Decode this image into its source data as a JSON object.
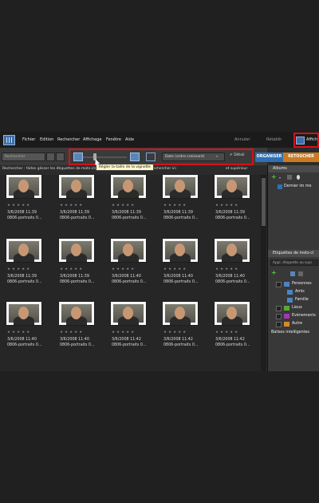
{
  "colors": {
    "accent_blue": "#2f6fb4",
    "accent_orange": "#c97a22",
    "highlight_red": "#d3121b"
  },
  "menu": {
    "items": [
      "Fichier",
      "Edition",
      "Rechercher",
      "Affichage",
      "Fenêtre",
      "Aide"
    ],
    "undo": "Annuler",
    "redo": "Rétablir",
    "afficher": "Affich"
  },
  "toolbar": {
    "search_label": "Rechercher",
    "sort_value": "Date (ordre croissant)",
    "detail_label": "✔ Détail",
    "slider_tooltip": "Régler la taille de la vignette"
  },
  "hint": {
    "text_left": "Rechercher : faites glisser les étiquettes de mots-clés",
    "text_mid": "rechercher ici",
    "text_right": "et supérieur"
  },
  "tabs": {
    "organize": "ORGANISER",
    "retouch": "RETOUCHER"
  },
  "photos": [
    {
      "date": "3/6/2008 11:39",
      "name": "0806-portraits 0..."
    },
    {
      "date": "3/6/2008 11:39",
      "name": "0806-portraits 0..."
    },
    {
      "date": "3/6/2008 11:39",
      "name": "0806-portraits 0..."
    },
    {
      "date": "3/6/2008 11:39",
      "name": "0806-portraits 0..."
    },
    {
      "date": "3/6/2008 11:39",
      "name": "0806-portraits 0..."
    },
    {
      "date": "3/6/2008 11:39",
      "name": "0806-portraits 0..."
    },
    {
      "date": "3/6/2008 11:39",
      "name": "0806-portraits 0..."
    },
    {
      "date": "3/6/2008 11:40",
      "name": "0806-portraits 0..."
    },
    {
      "date": "3/6/2008 11:40",
      "name": "0806-portraits 0..."
    },
    {
      "date": "3/6/2008 11:40",
      "name": "0806-portraits 0..."
    },
    {
      "date": "3/6/2008 11:40",
      "name": "0806-portraits 0..."
    },
    {
      "date": "3/6/2008 11:40",
      "name": "0806-portraits 0..."
    },
    {
      "date": "3/6/2008 11:42",
      "name": "0806-portraits 0..."
    },
    {
      "date": "3/6/2008 11:42",
      "name": "0806-portraits 0..."
    },
    {
      "date": "3/6/2008 11:42",
      "name": "0806-portraits 0..."
    }
  ],
  "stars": "★★★★★",
  "panel": {
    "albums_title": "Albums",
    "album_item": "Dernier im mo",
    "keywords_title": "Etiquettes de mots-cl",
    "keywords_search": "Appl. étiquette au sujo",
    "tags": [
      "Personnes",
      "Amis",
      "Famille",
      "Lieux",
      "Evénements",
      "Autre"
    ],
    "smart_tags": "Balises intelligentes"
  }
}
